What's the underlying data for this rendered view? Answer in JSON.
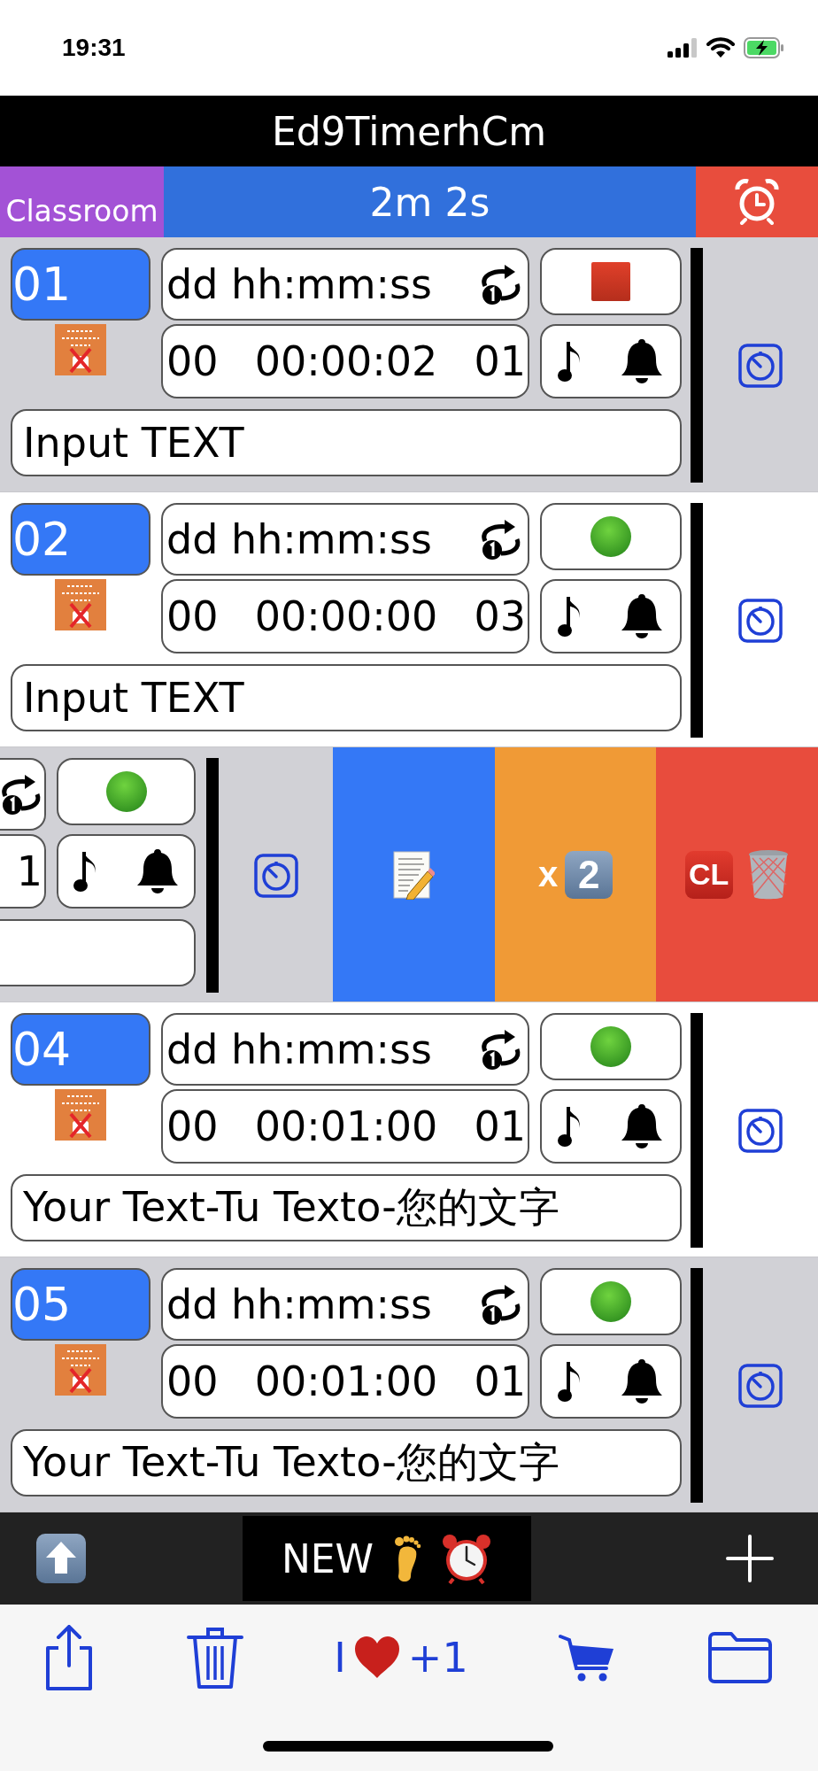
{
  "status_bar": {
    "time": "19:31"
  },
  "title": "Ed9TimerhCm",
  "nav": {
    "category": "Classroom",
    "total": "2m 2s"
  },
  "timers": [
    {
      "kind": "normal",
      "number": "01",
      "format": "dd hh:mm:ss",
      "days": "00",
      "time": "00:00:02",
      "repeats": "01",
      "running": true,
      "text": "Input TEXT"
    },
    {
      "kind": "normal",
      "number": "02",
      "format": "dd hh:mm:ss",
      "days": "00",
      "time": "00:00:00",
      "repeats": "03",
      "running": false,
      "text": "Input TEXT"
    },
    {
      "kind": "swiped",
      "repeats": "1",
      "running": false,
      "actions": [
        {
          "kind": "edit"
        },
        {
          "kind": "multiply",
          "label": "x",
          "keycap": "2"
        },
        {
          "kind": "clear",
          "keycap": "CL"
        }
      ]
    },
    {
      "kind": "normal",
      "number": "04",
      "format": "dd hh:mm:ss",
      "days": "00",
      "time": "00:01:00",
      "repeats": "01",
      "running": false,
      "text": "Your Text-Tu Texto-您的文字"
    },
    {
      "kind": "normal",
      "number": "05",
      "format": "dd hh:mm:ss",
      "days": "00",
      "time": "00:01:00",
      "repeats": "01",
      "running": false,
      "text": "Your Text-Tu Texto-您的文字"
    }
  ],
  "bottom_bar": {
    "new_label": "NEW"
  },
  "toolbar": {
    "like_prefix": "I",
    "like_suffix": "+1"
  }
}
